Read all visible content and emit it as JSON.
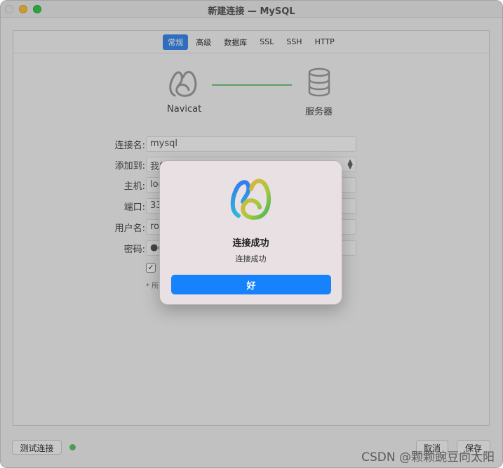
{
  "window": {
    "title": "新建连接 — MySQL"
  },
  "tabs": [
    {
      "label": "常规",
      "active": true
    },
    {
      "label": "高级",
      "active": false
    },
    {
      "label": "数据库",
      "active": false
    },
    {
      "label": "SSL",
      "active": false
    },
    {
      "label": "SSH",
      "active": false
    },
    {
      "label": "HTTP",
      "active": false
    }
  ],
  "graphic": {
    "client_label": "Navicat",
    "server_label": "服务器"
  },
  "form": {
    "connection_name": {
      "label": "连接名:",
      "value": "mysql"
    },
    "add_to": {
      "label": "添加到:",
      "value": "我的连接"
    },
    "host": {
      "label": "主机:",
      "value": "loc"
    },
    "port": {
      "label": "端口:",
      "value": "33"
    },
    "username": {
      "label": "用户名:",
      "value": "roo"
    },
    "password": {
      "label": "密码:",
      "value": "●●"
    },
    "checkbox_mark": "✓",
    "note": "* 所"
  },
  "footer": {
    "test_button": "测试连接",
    "cancel_button": "取消",
    "save_button": "保存",
    "watermark": "CSDN @颗颗豌豆向太阳"
  },
  "alert": {
    "title": "连接成功",
    "message": "连接成功",
    "ok_button": "好"
  },
  "colors": {
    "accent": "#1682fb",
    "tab_active": "#3a86e8",
    "connection_line": "#6fc07a",
    "status_ok": "#5fbf6a"
  }
}
